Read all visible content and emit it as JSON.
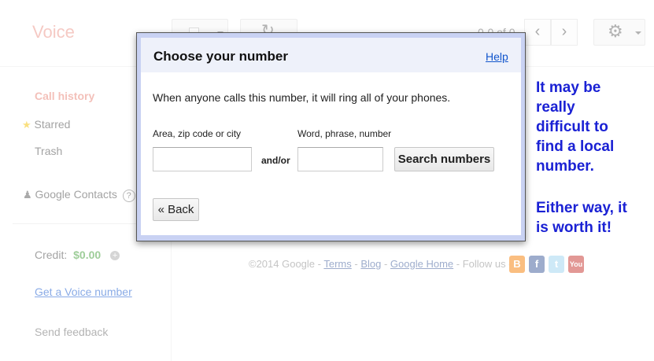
{
  "app": {
    "title": "Voice"
  },
  "toolbar": {
    "page_count": "0-0 of 0",
    "refresh_glyph": "↻",
    "prev_glyph": "‹",
    "next_glyph": "›",
    "gear_glyph": "⚙"
  },
  "sidebar": {
    "call_history": "Call history",
    "starred": "Starred",
    "trash": "Trash",
    "contacts": "Google Contacts",
    "help_mark": "?",
    "credit_label": "Credit:",
    "credit_value": "$0.00",
    "plus_glyph": "+",
    "get_number": "Get a Voice number",
    "send_feedback": "Send feedback"
  },
  "footer": {
    "copyright": "©2014 Google -",
    "terms": "Terms",
    "blog": "Blog",
    "home": "Google Home",
    "follow": "- Follow us on:"
  },
  "dialog": {
    "title": "Choose your number",
    "help": "Help",
    "message": "When anyone calls this number, it will ring all of your phones.",
    "area_label": "Area, zip code or city",
    "word_label": "Word, phrase, number",
    "andor": "and/or",
    "area_value": "",
    "word_value": "",
    "search_button": "Search numbers",
    "back_button": "« Back"
  },
  "annotation": {
    "line1": "It may be",
    "line2": "really",
    "line3": "difficult to",
    "line4": "find a local",
    "line5": "number.",
    "line6": "Either way, it",
    "line7": "is worth it!"
  },
  "icons": {
    "star": "star-icon",
    "person": "person-icon",
    "social": [
      "blogger-icon",
      "facebook-icon",
      "twitter-icon",
      "youtube-icon"
    ]
  },
  "colors": {
    "brand": "#dd4b39",
    "credit": "#3c9a32",
    "annotation": "#1a21d4",
    "dialog_border": "#c9d2f3"
  }
}
